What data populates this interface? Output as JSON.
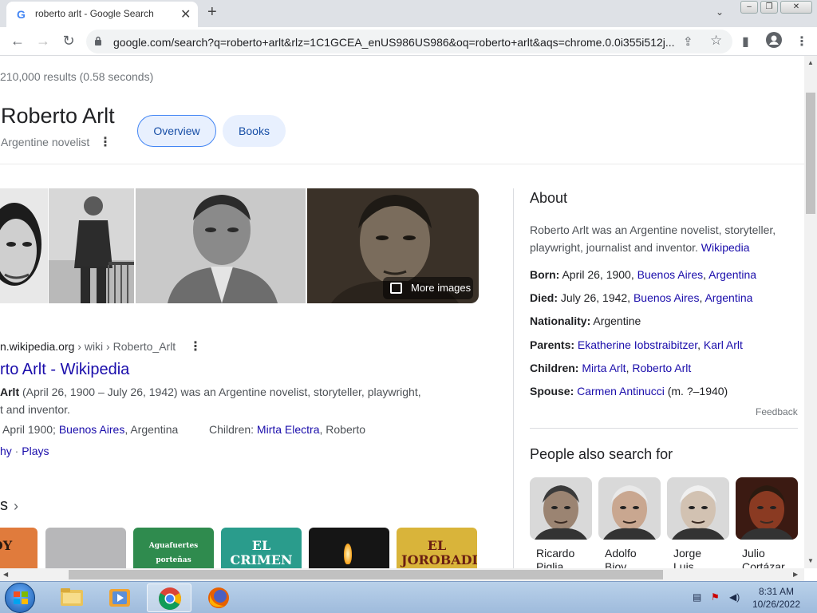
{
  "browser": {
    "tab_title": "roberto arlt - Google Search",
    "url": "google.com/search?q=roberto+arlt&rlz=1C1GCEA_enUS986US986&oq=roberto+arlt&aqs=chrome.0.0i355i512j..."
  },
  "search": {
    "result_stats": "210,000 results (0.58 seconds)"
  },
  "entity": {
    "title": "Roberto Arlt",
    "subtitle": "Argentine novelist",
    "chips": [
      "Overview",
      "Books"
    ],
    "more_images_label": "More images"
  },
  "result": {
    "cite_domain": "n.wikipedia.org",
    "cite_path": " › wiki › Roberto_Arlt",
    "title": "rto Arlt - Wikipedia",
    "snippet_bold": "Arlt",
    "snippet_rest": " (April 26, 1900 – July 26, 1942) was an Argentine novelist, storyteller, playwright,",
    "snippet_line2": "t and inventor.",
    "born_prefix": "April 1900; ",
    "born_link": "Buenos Aires",
    "born_suffix": ", Argentina",
    "children_label": "Children: ",
    "children_link": "Mirta Electra",
    "children_suffix": ", Roberto",
    "sublink_1": "hy",
    "sublink_sep": " · ",
    "sublink_2": "Plays"
  },
  "books_section": {
    "heading": "s",
    "covers": [
      {
        "text": "TOY",
        "bg": "#e07b3c"
      },
      {
        "text": "",
        "bg": "#b7b7b9"
      },
      {
        "text": "Aguafuertes porteñas",
        "bg": "#2f8b4e"
      },
      {
        "text": "EL CRIMEN",
        "bg": "#2a9c8c"
      },
      {
        "text": "",
        "bg": "#151515"
      },
      {
        "text": "EL JOROBADITO",
        "bg": "#d9b43a"
      }
    ]
  },
  "knowledge_panel": {
    "about_heading": "About",
    "description": "Roberto Arlt was an Argentine novelist, storyteller, playwright, journalist and inventor. ",
    "description_link": "Wikipedia",
    "facts": [
      {
        "label": "Born:",
        "text": " April 26, 1900, ",
        "links": [
          "Buenos Aires",
          "Argentina"
        ],
        "suffix": ""
      },
      {
        "label": "Died:",
        "text": " July 26, 1942, ",
        "links": [
          "Buenos Aires",
          "Argentina"
        ],
        "suffix": ""
      },
      {
        "label": "Nationality:",
        "text": " Argentine",
        "links": [],
        "suffix": ""
      },
      {
        "label": "Parents:",
        "text": " ",
        "links": [
          "Ekatherine Iobstraibitzer",
          "Karl Arlt"
        ],
        "suffix": ""
      },
      {
        "label": "Children:",
        "text": " ",
        "links": [
          "Mirta Arlt",
          "Roberto Arlt"
        ],
        "suffix": ""
      },
      {
        "label": "Spouse:",
        "text": " ",
        "links": [
          "Carmen Antinucci"
        ],
        "suffix": " (m. ?–1940)"
      }
    ],
    "feedback": "Feedback",
    "people_heading": "People also search for",
    "people": [
      {
        "name_line1": "Ricardo",
        "name_line2": "Piglia"
      },
      {
        "name_line1": "Adolfo",
        "name_line2": "Bioy"
      },
      {
        "name_line1": "Jorge",
        "name_line2": "Luis"
      },
      {
        "name_line1": "Julio",
        "name_line2": "Cortázar"
      }
    ]
  },
  "taskbar": {
    "time": "8:31 AM",
    "date": "10/26/2022"
  },
  "colors": {
    "link": "#1a0dab",
    "chip_bg": "#e8f0fe",
    "accent_blue": "#4285f4"
  }
}
